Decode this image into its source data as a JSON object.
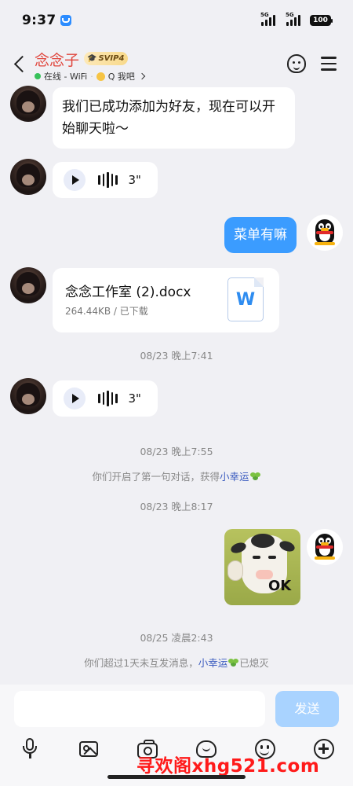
{
  "status_bar": {
    "time": "9:37",
    "signal_1": "5G",
    "signal_2": "5G",
    "battery": "100"
  },
  "header": {
    "contact_name": "念念子",
    "vip_badge": "SVIP4",
    "online_status": "在线 - WiFi",
    "qq_search": "Q 我吧",
    "accent_color": "#e0453c"
  },
  "messages": {
    "m1_text": "我们已成功添加为好友，现在可以开始聊天啦～",
    "m2_voice_duration": "3\"",
    "m3_sent_text": "菜单有嘛",
    "m4_file": {
      "name": "念念工作室 (2).docx",
      "meta": "264.44KB / 已下载",
      "icon_letter": "W"
    },
    "ts1": "08/23 晚上7:41",
    "m5_voice_duration": "3\"",
    "ts2": "08/23 晚上7:55",
    "sys1_prefix": "你们开启了第一句对话，获得",
    "sys1_link": "小幸运",
    "ts3": "08/23 晚上8:17",
    "m6_sticker_text": "OK",
    "ts4": "08/25 凌晨2:43",
    "sys2_prefix": "你们超过1天未互发消息，",
    "sys2_link": "小幸运",
    "sys2_suffix": "已熄灭"
  },
  "input_bar": {
    "input_value": "",
    "send_label": "发送"
  },
  "toolbar_icons": [
    "mic-icon",
    "image-icon",
    "camera-icon",
    "red-packet-icon",
    "emoji-icon",
    "plus-icon"
  ],
  "watermark": "寻欢阁xhg521.com",
  "colors": {
    "sent_bubble": "#3b9cff",
    "send_button": "#a9d3ff",
    "link": "#3a5bbf"
  }
}
